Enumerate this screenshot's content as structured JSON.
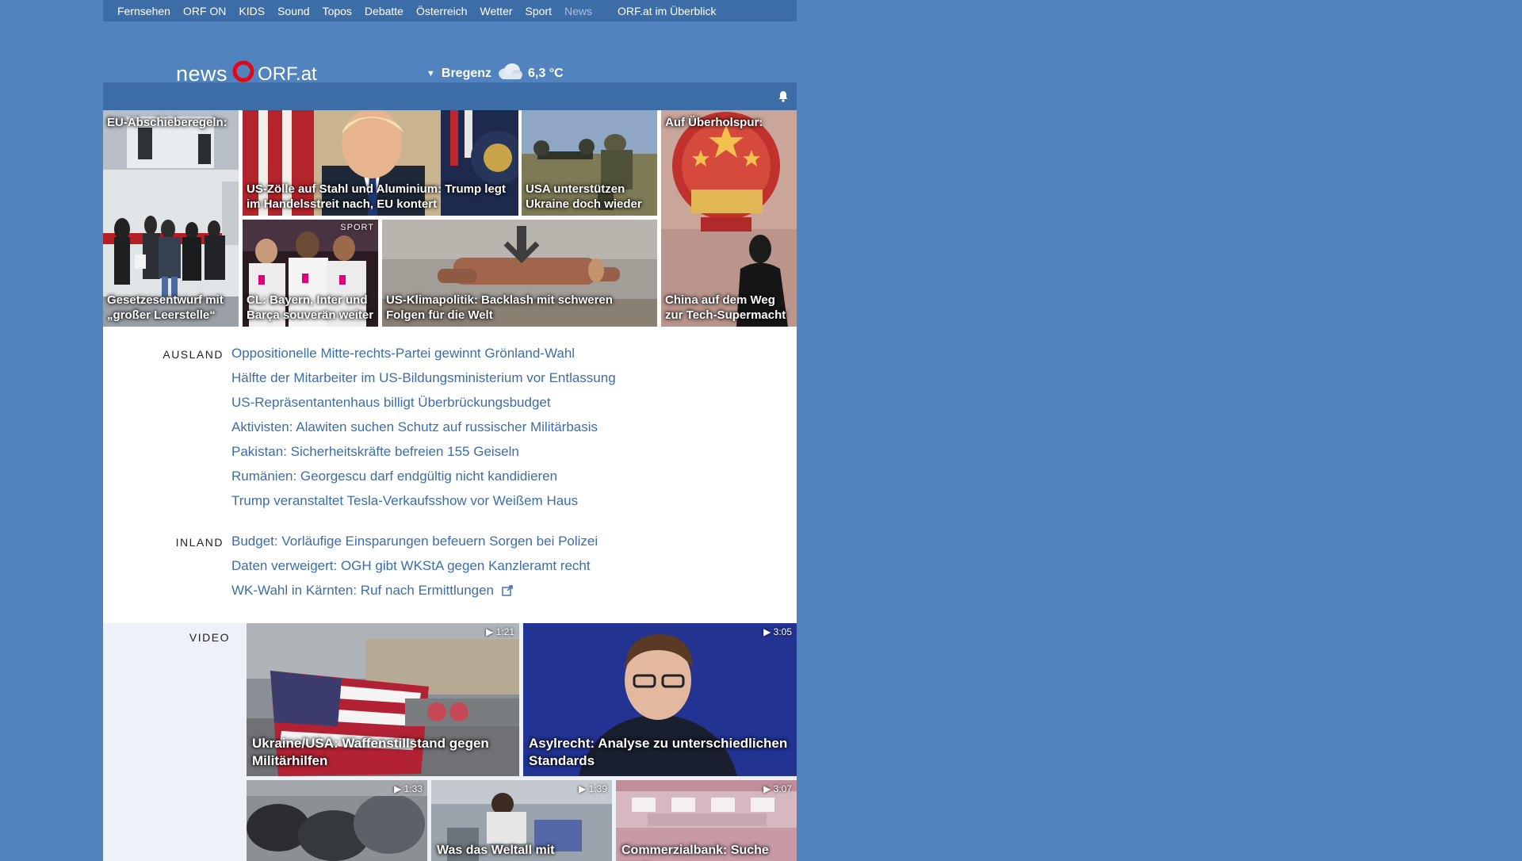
{
  "topnav": {
    "items": [
      "Fernsehen",
      "ORF ON",
      "KIDS",
      "Sound",
      "Topos",
      "Debatte",
      "Österreich",
      "Wetter",
      "Sport",
      "News"
    ],
    "current": "News",
    "overview": "ORF.at im Überblick"
  },
  "header": {
    "logo_news": "news",
    "logo_orf": "ORF.at",
    "weather": {
      "city": "Bregenz",
      "temp": "6,3 °C",
      "icon": "cloud-icon"
    }
  },
  "colors": {
    "background": "#5183be",
    "nav": "#3d6da6",
    "link": "#3d6da6",
    "brand_red": "#e30613"
  },
  "mosaic": {
    "eu_top": "EU-Abschieberegeln:",
    "eu_bottom": "Gesetzesentwurf mit „großer Leerstelle“",
    "trump": "US-Zölle auf Stahl und Aluminium: Trump legt im Handelsstreit nach, EU kontert",
    "ukraine": "USA unterstützen Ukraine doch wieder",
    "china_top": "Auf Überholspur:",
    "china_bottom": "China auf dem Weg zur Tech-Supermacht",
    "bayern": "CL: Bayern, Inter und Barça souverän weiter",
    "bayern_tag": "SPORT",
    "klima": "US-Klimapolitik: Backlash mit schweren Folgen für die Welt"
  },
  "sections": [
    {
      "label": "AUSLAND",
      "items": [
        "Oppositionelle Mitte-rechts-Partei gewinnt Grönland-Wahl",
        "Hälfte der Mitarbeiter im US-Bildungsministerium vor Entlassung",
        "US-Repräsentantenhaus billigt Überbrückungsbudget",
        "Aktivisten: Alawiten suchen Schutz auf russischer Militärbasis",
        "Pakistan: Sicherheitskräfte befreien 155 Geiseln",
        "Rumänien: Georgescu darf endgültig nicht kandidieren",
        "Trump veranstaltet Tesla-Verkaufsshow vor Weißem Haus"
      ]
    },
    {
      "label": "INLAND",
      "items": [
        "Budget: Vorläufige Einsparungen befeuern Sorgen bei Polizei",
        "Daten verweigert: OGH gibt WKStA gegen Kanzleramt recht",
        "WK-Wahl in Kärnten: Ruf nach Ermittlungen"
      ]
    }
  ],
  "video": {
    "label": "VIDEO",
    "items": [
      {
        "title": "Ukraine/USA: Waffenstillstand gegen Militärhilfen",
        "duration": "1:21"
      },
      {
        "title": "Asylrecht: Analyse zu unterschiedlichen Standards",
        "duration": "3:05"
      },
      {
        "title": "",
        "duration": "1:33"
      },
      {
        "title": "Was das Weltall mit",
        "duration": "1:39"
      },
      {
        "title": "Commerzialbank: Suche nach",
        "duration": "3:07"
      }
    ]
  }
}
